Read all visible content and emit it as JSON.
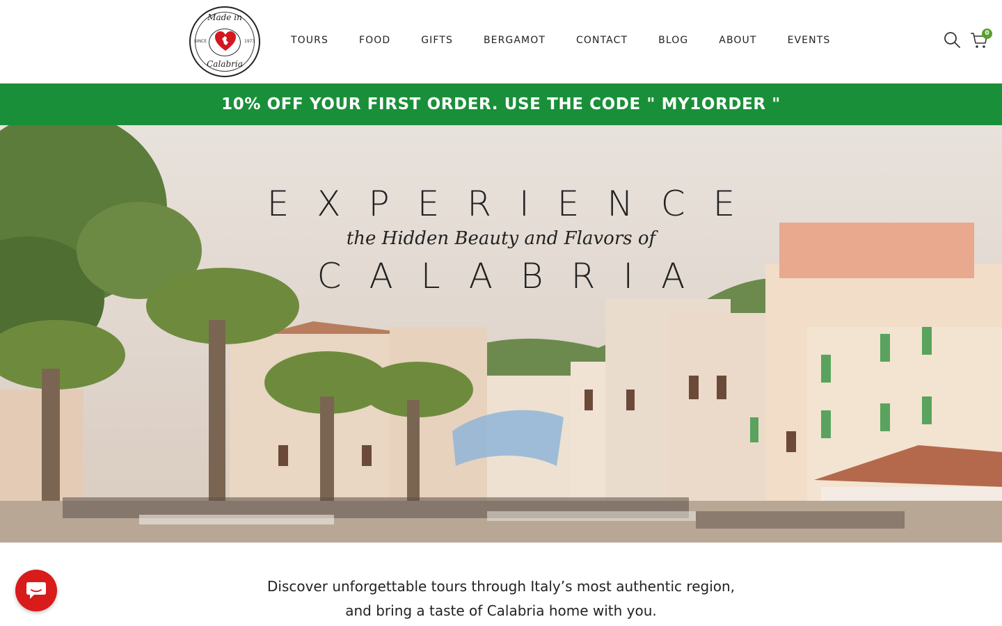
{
  "brand": {
    "logo_top_text": "Made in",
    "logo_bottom_text": "Calabria",
    "logo_since": "SINCE",
    "logo_year": "1973"
  },
  "nav": {
    "items": [
      "TOURS",
      "FOOD",
      "GIFTS",
      "BERGAMOT",
      "CONTACT",
      "BLOG",
      "ABOUT",
      "EVENTS"
    ]
  },
  "header_icons": {
    "search_icon": "search-icon",
    "cart_icon": "cart-icon",
    "cart_count": "0"
  },
  "promo": {
    "text": "10% OFF YOUR FIRST ORDER. USE THE CODE \" MY1ORDER \""
  },
  "hero": {
    "line1": "EXPERIENCE",
    "line2": "the Hidden Beauty and Flavors of",
    "line3": "CALABRIA"
  },
  "intro": {
    "line1": "Discover unforgettable tours through Italy’s most authentic region,",
    "line2": "and bring a taste of Calabria home with you."
  },
  "colors": {
    "promo_bg": "#1a8f3a",
    "chat_bg": "#d81b1b",
    "badge_bg": "#5aa02c"
  }
}
